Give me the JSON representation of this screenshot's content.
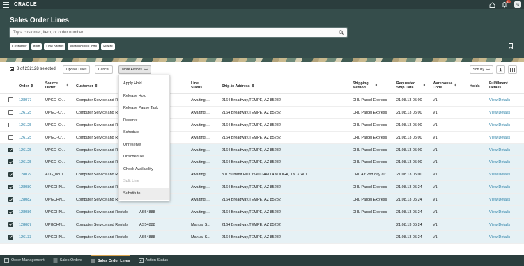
{
  "topbar": {
    "brand": "ORACLE",
    "notif_count": "11",
    "avatar": "PN",
    "icons": [
      "menu-icon",
      "home-icon",
      "bell-icon"
    ]
  },
  "header": {
    "title": "Sales Order Lines",
    "search_placeholder": "Try a customer, item, or order number",
    "chips": [
      "Customer",
      "Item",
      "Line Status",
      "Warehouse Code",
      "Filters"
    ]
  },
  "toolbar": {
    "selected": "8 of 232128 selected",
    "update_lines": "Update Lines",
    "cancel": "Cancel",
    "more_actions": "More Actions",
    "sort_by": "Sort By"
  },
  "menu": {
    "items": [
      {
        "label": "Apply Hold",
        "state": "normal"
      },
      {
        "label": "Release Hold",
        "state": "normal"
      },
      {
        "label": "Release Pause Task",
        "state": "normal"
      },
      {
        "label": "Reserve",
        "state": "normal"
      },
      {
        "label": "Schedule",
        "state": "normal"
      },
      {
        "label": "Unreserve",
        "state": "normal"
      },
      {
        "label": "Unschedule",
        "state": "normal"
      },
      {
        "label": "Check Availability",
        "state": "normal"
      },
      {
        "label": "Split Line",
        "state": "disabled"
      },
      {
        "label": "Substitute",
        "state": "highlighted"
      }
    ]
  },
  "table": {
    "headers": {
      "order": "Order",
      "source_order": "Source Order",
      "customer": "Customer",
      "line_status": "Line Status",
      "ship_to": "Ship-to Address",
      "shipping_method": "Shipping Method",
      "requested_ship_date": "Requested Ship Date",
      "warehouse_code": "Warehouse Code",
      "holds": "Holds",
      "fulfillment_details": "Fulfillment Details"
    },
    "rows": [
      {
        "order": "128077",
        "source": "UPGO-Cr...",
        "customer": "Computer Service and R",
        "item": "",
        "status": "Awaiting ...",
        "address": "2164 Broadway,TEMPE, AZ 85282",
        "method": "DHL Parcel Express",
        "date": "21.08.13 05:00",
        "wh": "V1",
        "details": "View Details",
        "checked": false
      },
      {
        "order": "126125",
        "source": "UPGO-Cr...",
        "customer": "Computer Service and R",
        "item": "",
        "status": "Awaiting ...",
        "address": "2164 Broadway,TEMPE, AZ 85282",
        "method": "DHL Parcel Express",
        "date": "21.08.13 05:00",
        "wh": "V1",
        "details": "View Details",
        "checked": false
      },
      {
        "order": "126125",
        "source": "UPGO-Cr...",
        "customer": "Computer Service and R",
        "item": "",
        "status": "Awaiting ...",
        "address": "2164 Broadway,TEMPE, AZ 85282",
        "method": "DHL Parcel Express",
        "date": "21.08.13 05:00",
        "wh": "V1",
        "details": "View Details",
        "checked": false
      },
      {
        "order": "126125",
        "source": "UPGO-Cr...",
        "customer": "Computer Service and R",
        "item": "",
        "status": "Awaiting ...",
        "address": "2164 Broadway,TEMPE, AZ 85282",
        "method": "DHL Parcel Express",
        "date": "21.08.13 05:00",
        "wh": "V1",
        "details": "View Details",
        "checked": false
      },
      {
        "order": "126125",
        "source": "UPGO-Cr...",
        "customer": "Computer Service and R",
        "item": "",
        "status": "Awaiting ...",
        "address": "2164 Broadway,TEMPE, AZ 85282",
        "method": "DHL Parcel Express",
        "date": "21.08.13 05:00",
        "wh": "V1",
        "details": "View Details",
        "checked": true
      },
      {
        "order": "126125",
        "source": "UPGO-Cr...",
        "customer": "Computer Service and R",
        "item": "",
        "status": "Awaiting ...",
        "address": "2164 Broadway,TEMPE, AZ 85282",
        "method": "DHL Parcel Express",
        "date": "21.08.13 05:00",
        "wh": "V1",
        "details": "View Details",
        "checked": true
      },
      {
        "order": "128079",
        "source": "ATG_0801",
        "customer": "Computer Service and R",
        "item": "",
        "status": "Awaiting ...",
        "address": "301 Summit Hill Drive,CHATTANOOGA, TN 37401",
        "method": "DHL Air 2nd day air",
        "date": "21.08.13 05:00",
        "wh": "V1",
        "details": "View Details",
        "checked": true
      },
      {
        "order": "128080",
        "source": "UPGCHN...",
        "customer": "Computer Service and R",
        "item": "",
        "status": "Awaiting ...",
        "address": "2164 Broadway,TEMPE, AZ 85282",
        "method": "DHL Parcel Express",
        "date": "21.08.13 05:24",
        "wh": "V1",
        "details": "View Details",
        "checked": true
      },
      {
        "order": "128082",
        "source": "UPGCHN...",
        "customer": "Computer Service and R",
        "item": "",
        "status": "Awaiting ...",
        "address": "2164 Broadway,TEMPE, AZ 85282",
        "method": "DHL Parcel Express",
        "date": "21.08.13 05:24",
        "wh": "V1",
        "details": "View Details",
        "checked": true
      },
      {
        "order": "128086",
        "source": "UPGCHN...",
        "customer": "Computer Service and Rentals",
        "item": "AS54888",
        "status": "Awaiting ...",
        "address": "2164 Broadway,TEMPE, AZ 85282",
        "method": "DHL Parcel Express",
        "date": "21.08.13 05:24",
        "wh": "V1",
        "details": "View Details",
        "checked": true
      },
      {
        "order": "128087",
        "source": "UPGCHN...",
        "customer": "Computer Service and Rentals",
        "item": "AS54888",
        "status": "Manual S...",
        "address": "2164 Broadway,TEMPE, AZ 85282",
        "method": "",
        "date": "21.08.13 05:24",
        "wh": "V1",
        "details": "View Details",
        "checked": true
      },
      {
        "order": "126133",
        "source": "UPGCHN...",
        "customer": "Computer Service and Rentals",
        "item": "AS54888",
        "status": "Manual S...",
        "address": "2164 Broadway,TEMPE, AZ 85282",
        "method": "",
        "date": "21.08.13 05:24",
        "wh": "V1",
        "details": "View Details",
        "checked": true
      }
    ]
  },
  "bottomnav": {
    "items": [
      {
        "label": "Order Management",
        "icon": "dashboard-icon",
        "current": false
      },
      {
        "label": "Sales Orders",
        "icon": "orders-icon",
        "current": false
      },
      {
        "label": "Sales Order Lines",
        "icon": "lines-icon",
        "current": true
      },
      {
        "label": "Action Status",
        "icon": "status-icon",
        "current": false
      }
    ]
  },
  "colors": {
    "header_bg": "#354d4b",
    "topbar_bg": "#2b3d3d",
    "link": "#227ca3",
    "selected_row": "#e6f1f5",
    "accent": "#d8a34d"
  }
}
